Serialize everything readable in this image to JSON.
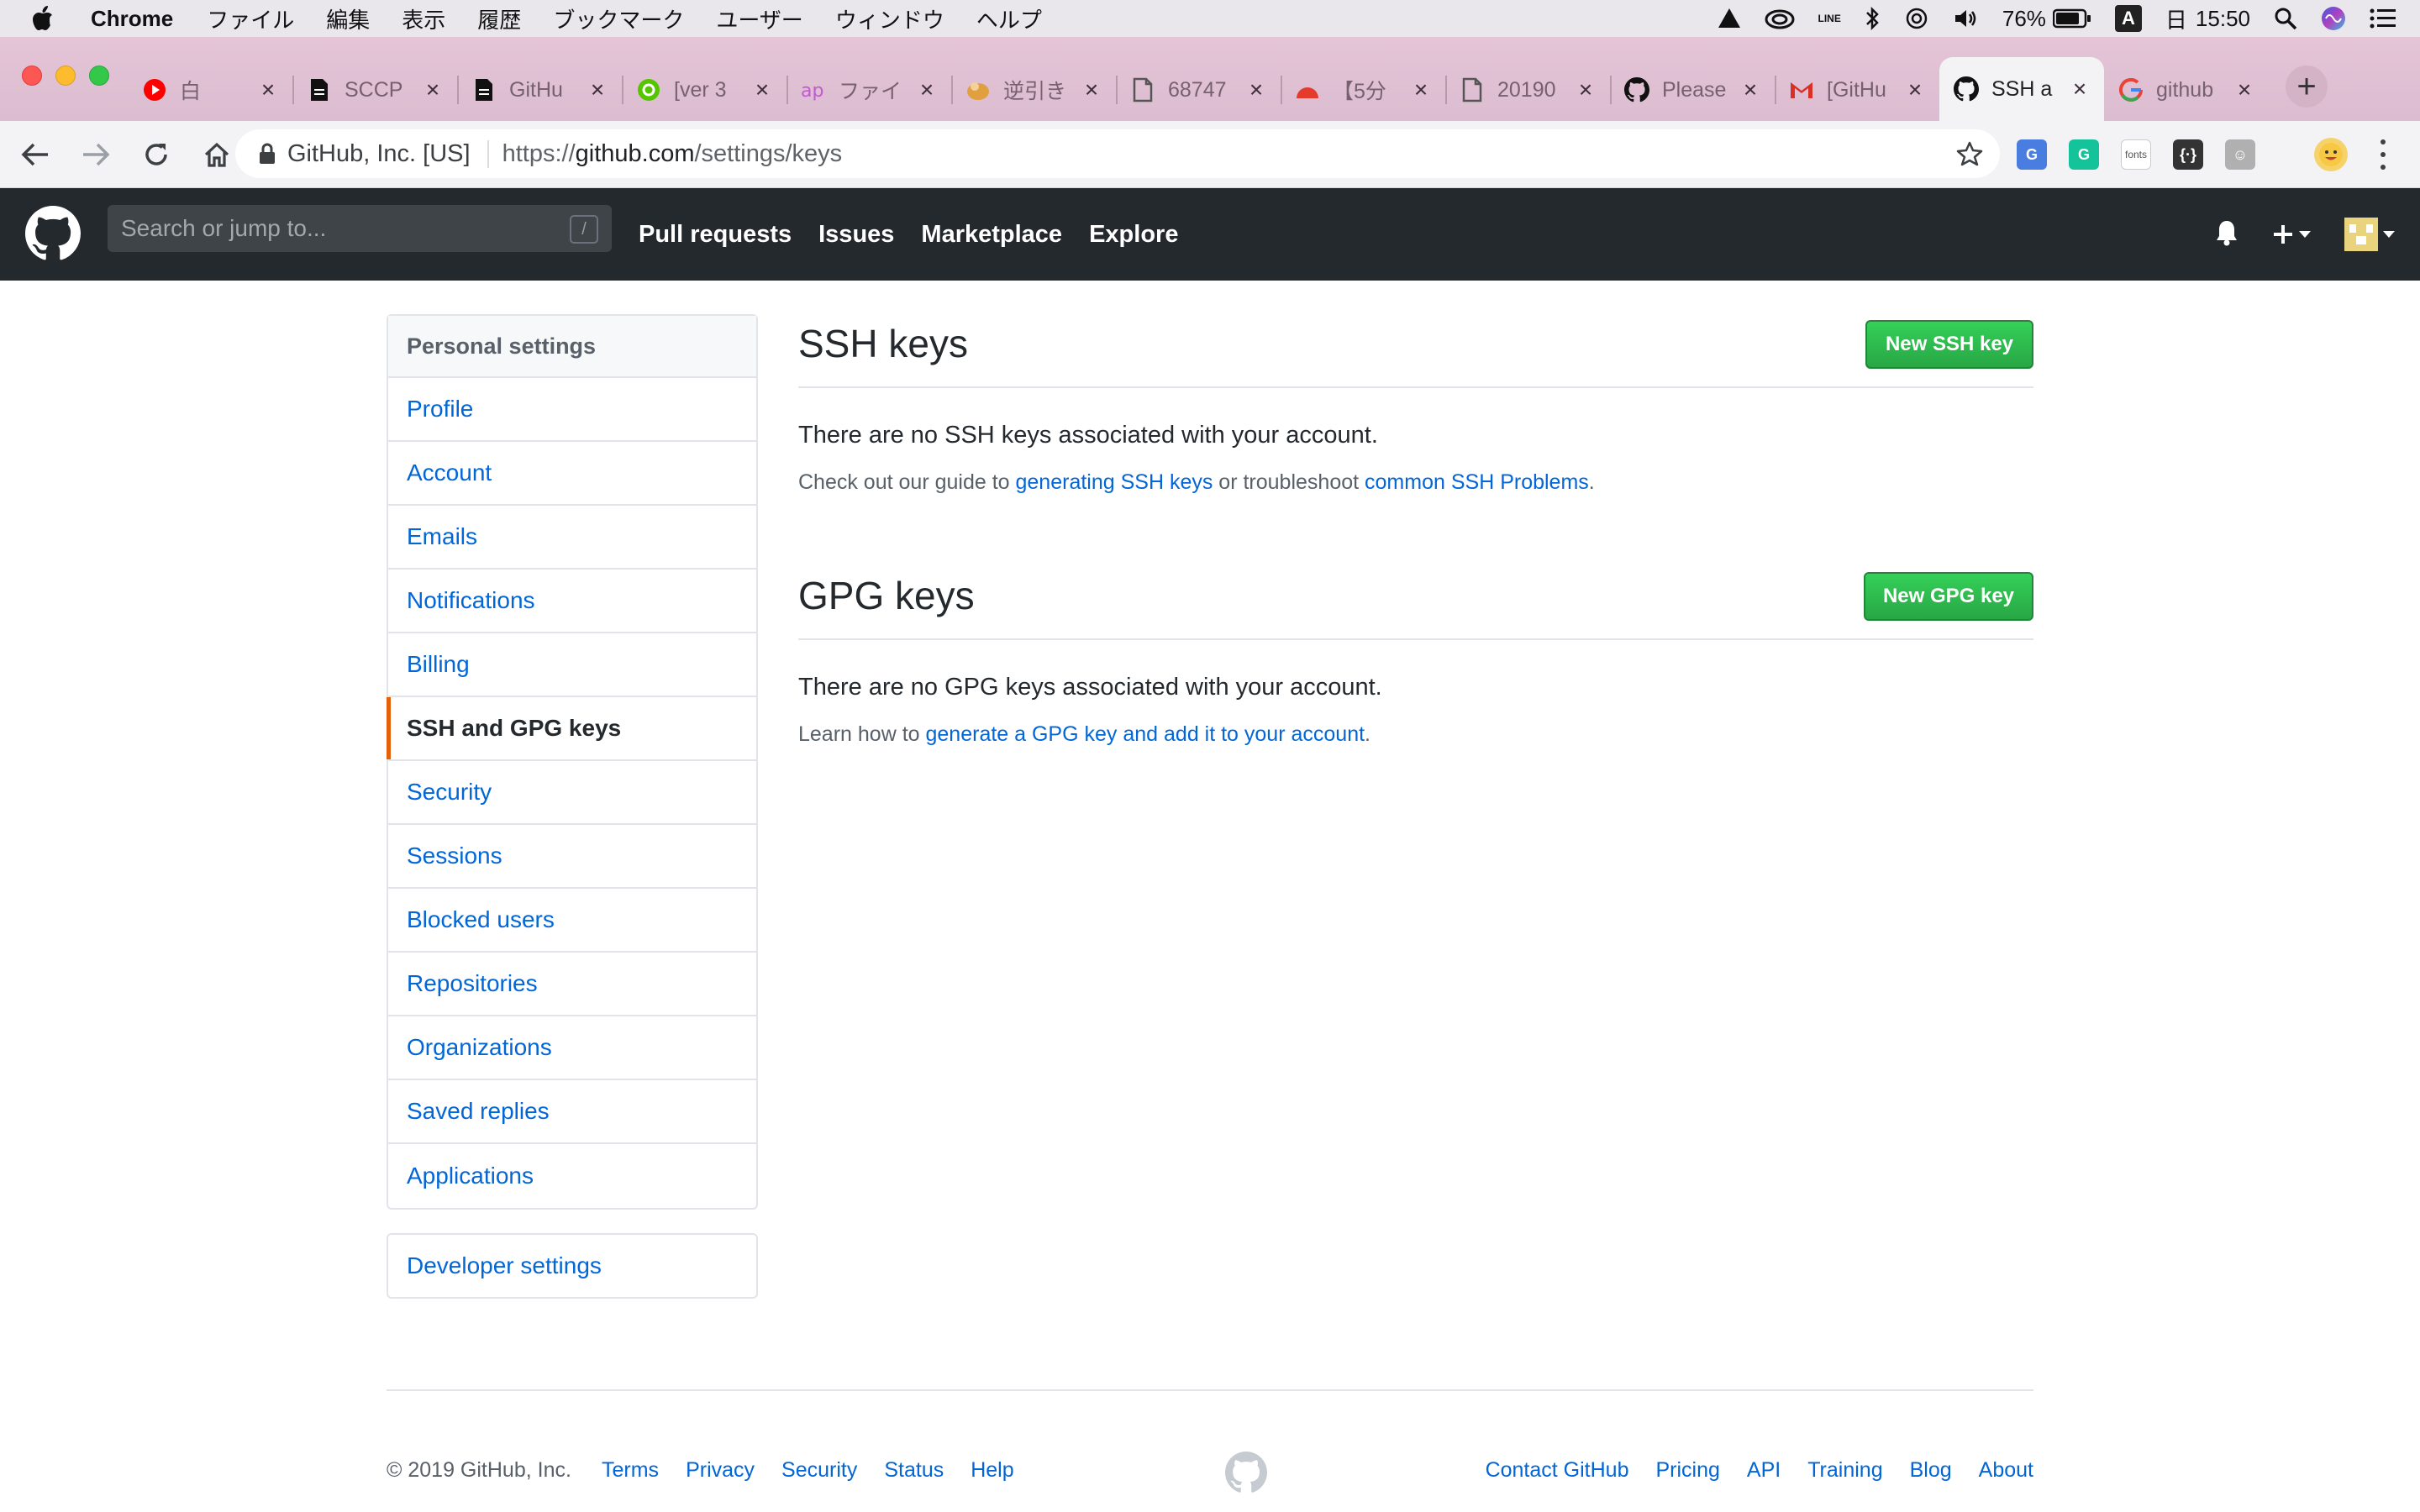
{
  "menubar": {
    "app_name": "Chrome",
    "items": [
      "ファイル",
      "編集",
      "表示",
      "履歴",
      "ブックマーク",
      "ユーザー",
      "ウィンドウ",
      "ヘルプ"
    ],
    "battery": "76%",
    "day": "日",
    "time": "15:50",
    "ime": "A",
    "line_label": "LINE"
  },
  "tabs": [
    {
      "title": "白",
      "icon": "youtube-icon",
      "color": "#ff0000"
    },
    {
      "title": "SCCP",
      "icon": "document-icon",
      "color": "#111111"
    },
    {
      "title": "GitHu",
      "icon": "document-icon",
      "color": "#111111"
    },
    {
      "title": "[ver 3",
      "icon": "qiita-icon",
      "color": "#55c500"
    },
    {
      "title": "ファイ",
      "icon": "ap-icon",
      "color": "#c05ad0"
    },
    {
      "title": "逆引き",
      "icon": "ruby-icon",
      "color": "#e0a040"
    },
    {
      "title": "68747",
      "icon": "file-icon",
      "color": "#555555"
    },
    {
      "title": "【5分",
      "icon": "red-dot-icon",
      "color": "#e53b2c"
    },
    {
      "title": "20190",
      "icon": "file-icon",
      "color": "#555555"
    },
    {
      "title": "Please",
      "icon": "github-icon",
      "color": "#111111"
    },
    {
      "title": "[GitHu",
      "icon": "gmail-icon",
      "color": "#d93025"
    },
    {
      "title": "SSH a",
      "icon": "github-icon",
      "color": "#111111",
      "active": true
    },
    {
      "title": "github",
      "icon": "google-icon",
      "color": "#4285f4"
    }
  ],
  "omnibox": {
    "site": "GitHub, Inc. [US]",
    "url_scheme": "https://",
    "url_host": "github.com",
    "url_path": "/settings/keys"
  },
  "extensions": [
    {
      "name": "translate-icon",
      "label": "G",
      "color": "#4a7de0"
    },
    {
      "name": "grammarly-icon",
      "label": "G",
      "color": "#15c39a"
    },
    {
      "name": "fonts-icon",
      "label": "fonts",
      "color": "#ffffff"
    },
    {
      "name": "code-icon",
      "label": "{·}",
      "color": "#333333"
    },
    {
      "name": "ghost-icon",
      "label": "☺",
      "color": "#b0b0b0"
    }
  ],
  "gh_header": {
    "search_placeholder": "Search or jump to...",
    "search_hint": "/",
    "nav": [
      "Pull requests",
      "Issues",
      "Marketplace",
      "Explore"
    ]
  },
  "sidebar": {
    "heading": "Personal settings",
    "items": [
      "Profile",
      "Account",
      "Emails",
      "Notifications",
      "Billing",
      "SSH and GPG keys",
      "Security",
      "Sessions",
      "Blocked users",
      "Repositories",
      "Organizations",
      "Saved replies",
      "Applications"
    ],
    "selected": "SSH and GPG keys",
    "developer": "Developer settings"
  },
  "ssh": {
    "title": "SSH keys",
    "button": "New SSH key",
    "message": "There are no SSH keys associated with your account.",
    "note_pre": "Check out our guide to ",
    "note_link1": "generating SSH keys",
    "note_mid": " or troubleshoot ",
    "note_link2": "common SSH Problems",
    "note_post": "."
  },
  "gpg": {
    "title": "GPG keys",
    "button": "New GPG key",
    "message": "There are no GPG keys associated with your account.",
    "note_pre": "Learn how to ",
    "note_link": "generate a GPG key and add it to your account",
    "note_post": "."
  },
  "footer": {
    "copyright": "© 2019 GitHub, Inc.",
    "left_links": [
      "Terms",
      "Privacy",
      "Security",
      "Status",
      "Help"
    ],
    "right_links": [
      "Contact GitHub",
      "Pricing",
      "API",
      "Training",
      "Blog",
      "About"
    ]
  },
  "colors": {
    "link": "#0366d6",
    "green": "#28a745",
    "header": "#24292e",
    "selected_accent": "#e36209"
  }
}
